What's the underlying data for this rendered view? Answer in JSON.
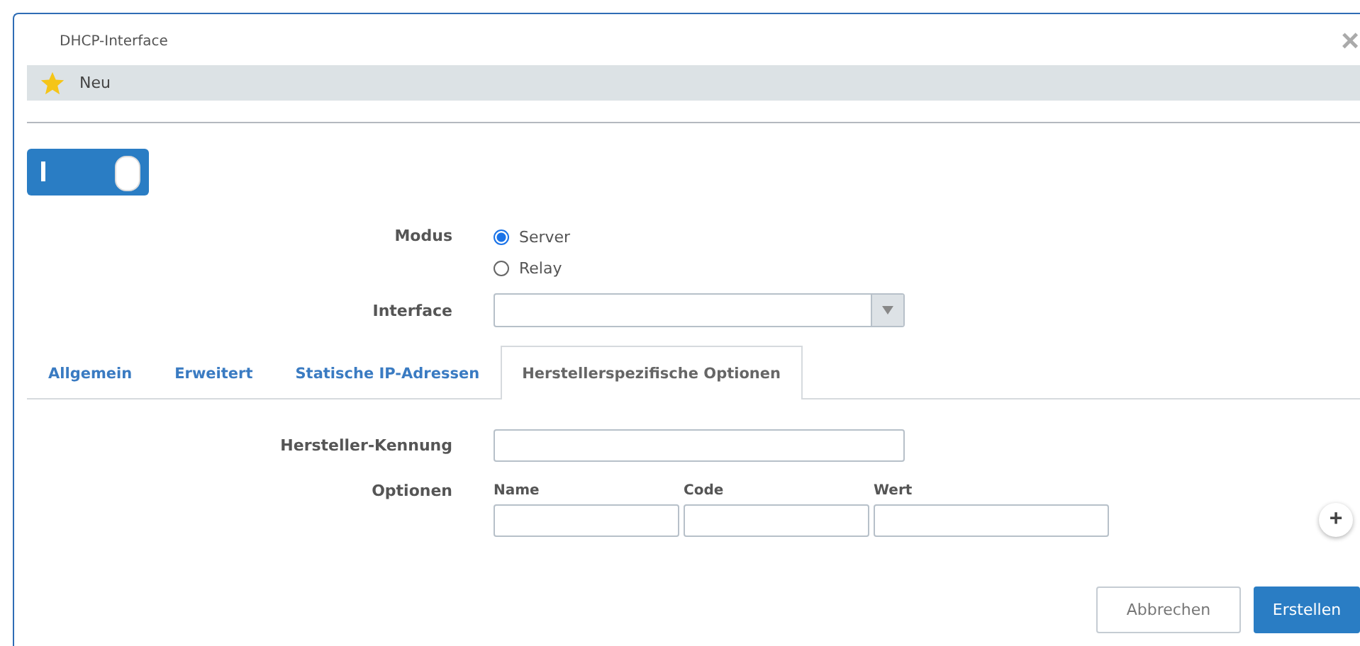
{
  "window": {
    "title": "DHCP-Interface",
    "close": "×"
  },
  "header": {
    "label": "Neu"
  },
  "toggle": {
    "on": true
  },
  "mode": {
    "label": "Modus",
    "options": [
      {
        "label": "Server",
        "selected": true
      },
      {
        "label": "Relay",
        "selected": false
      }
    ]
  },
  "interface": {
    "label": "Interface"
  },
  "tabs": [
    {
      "label": "Allgemein",
      "selected": false
    },
    {
      "label": "Erweitert",
      "selected": false
    },
    {
      "label": "Statische IP-Adressen",
      "selected": false
    },
    {
      "label": "Herstellerspezifische Optionen",
      "selected": true
    }
  ],
  "vendor_id": {
    "label": "Hersteller-Kennung"
  },
  "options": {
    "label": "Optionen",
    "columns": [
      "Name",
      "Code",
      "Wert"
    ],
    "add": "+"
  },
  "buttons": [
    {
      "label": "Abbrechen",
      "kind": "secondary"
    },
    {
      "label": "Erstellen",
      "kind": "primary"
    }
  ]
}
